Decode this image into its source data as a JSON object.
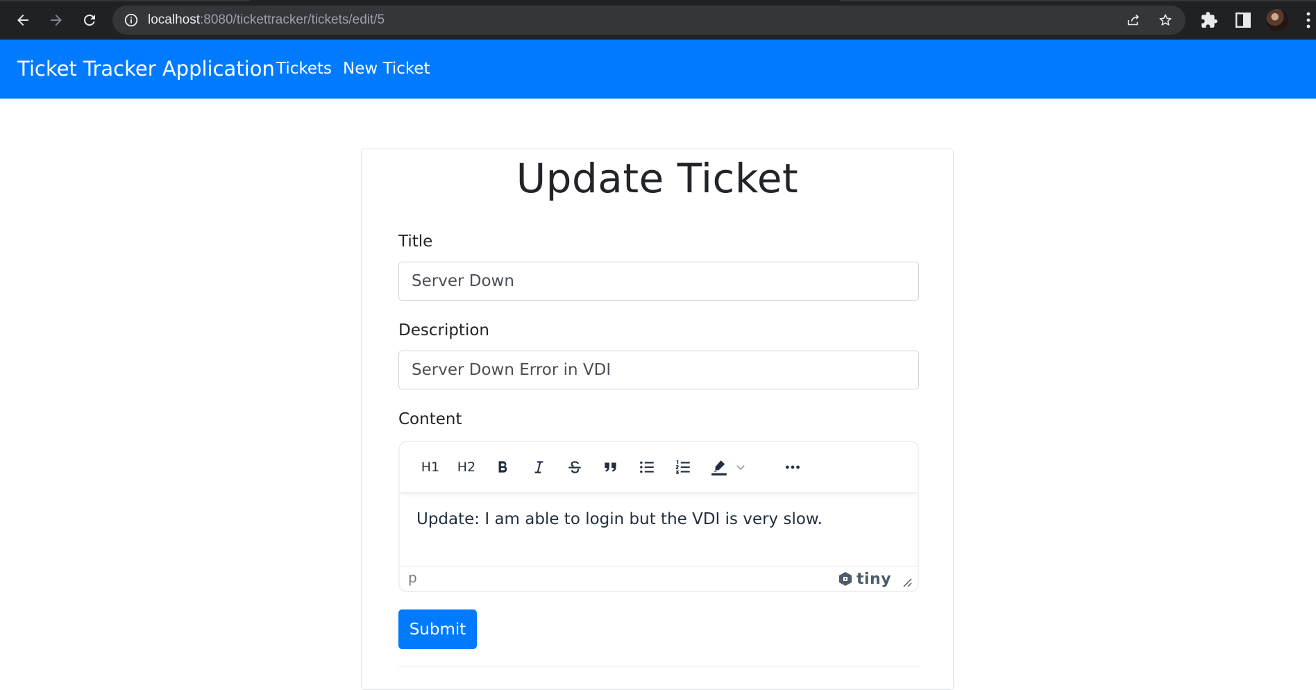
{
  "browser": {
    "url_host": "localhost",
    "url_path": ":8080/tickettracker/tickets/edit/5"
  },
  "navbar": {
    "brand": "Ticket Tracker Application",
    "links": [
      "Tickets",
      "New Ticket"
    ],
    "background": "#007bff"
  },
  "form": {
    "heading": "Update Ticket",
    "title_label": "Title",
    "title_value": "Server Down",
    "description_label": "Description",
    "description_value": "Server Down Error in VDI",
    "content_label": "Content",
    "submit_label": "Submit"
  },
  "editor": {
    "toolbar": {
      "h1": "H1",
      "h2": "H2",
      "icons": [
        "bold-icon",
        "italic-icon",
        "strikethrough-icon",
        "blockquote-icon",
        "bullet-list-icon",
        "numbered-list-icon",
        "highlight-icon",
        "chevron-down-icon",
        "more-icon"
      ]
    },
    "content": "Update: I am able to login but the VDI is very slow.",
    "status_path": "p",
    "branding": "tiny"
  }
}
